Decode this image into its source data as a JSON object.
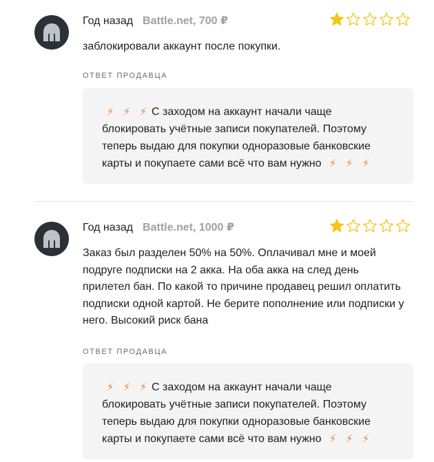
{
  "reviews": [
    {
      "date": "Год назад",
      "product": "Battle.net, 700 ₽",
      "rating": 1,
      "max_rating": 5,
      "text": "заблокировали аккаунт после покупки.",
      "reply_label": "ОТВЕТ ПРОДАВЦА",
      "reply_text": "С заходом на аккаунт начали чаще блокировать учётные записи покупателей. Поэтому теперь выдаю для покупки одноразовые банковские карты и покупаете сами всё что вам нужно",
      "reply_icon": "lightning-icon"
    },
    {
      "date": "Год назад",
      "product": "Battle.net, 1000 ₽",
      "rating": 1,
      "max_rating": 5,
      "text": "Заказ был разделен 50% на 50%. Оплачивал мне и моей подруге подписки на 2 акка. На оба акка на след день прилетел бан. По какой то причине продавец решил оплатить подписки одной картой. Не берите пополнение или подписки у него. Высокий риск бана",
      "reply_label": "ОТВЕТ ПРОДАВЦА",
      "reply_text": "С заходом на аккаунт начали чаще блокировать учётные записи покупателей. Поэтому теперь выдаю для покупки одноразовые банковские карты и покупаете сами всё что вам нужно",
      "reply_icon": "lightning-icon"
    }
  ],
  "colors": {
    "star_filled": "#f5c518",
    "star_empty_stroke": "#f5c518",
    "bolt": "#e8873a",
    "avatar_bg": "#2b3137"
  }
}
